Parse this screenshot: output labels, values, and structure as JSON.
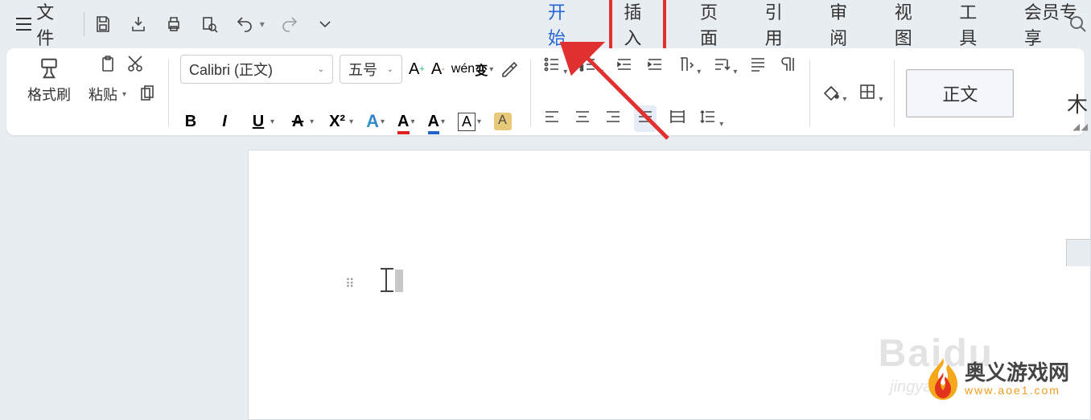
{
  "topbar": {
    "file_label": "文件"
  },
  "tabs": {
    "start": "开始",
    "insert": "插入",
    "page": "页面",
    "reference": "引用",
    "review": "审阅",
    "view": "视图",
    "tools": "工具",
    "member": "会员专享"
  },
  "ribbon": {
    "format_painter": "格式刷",
    "paste": "粘贴",
    "font_name": "Calibri (正文)",
    "font_size": "五号",
    "style_normal": "正文",
    "bold": "B",
    "italic": "I",
    "underline": "U",
    "strike": "A",
    "superscript": "X²",
    "text_effect": "A",
    "font_color": "A",
    "highlight_color": "A",
    "font_border": "A",
    "char_shade": "A"
  },
  "watermark": {
    "site_name": "奥义游戏网",
    "site_url": "www.aoe1.com",
    "baidu": "Baidu",
    "baidu_sub": "jingyan."
  }
}
